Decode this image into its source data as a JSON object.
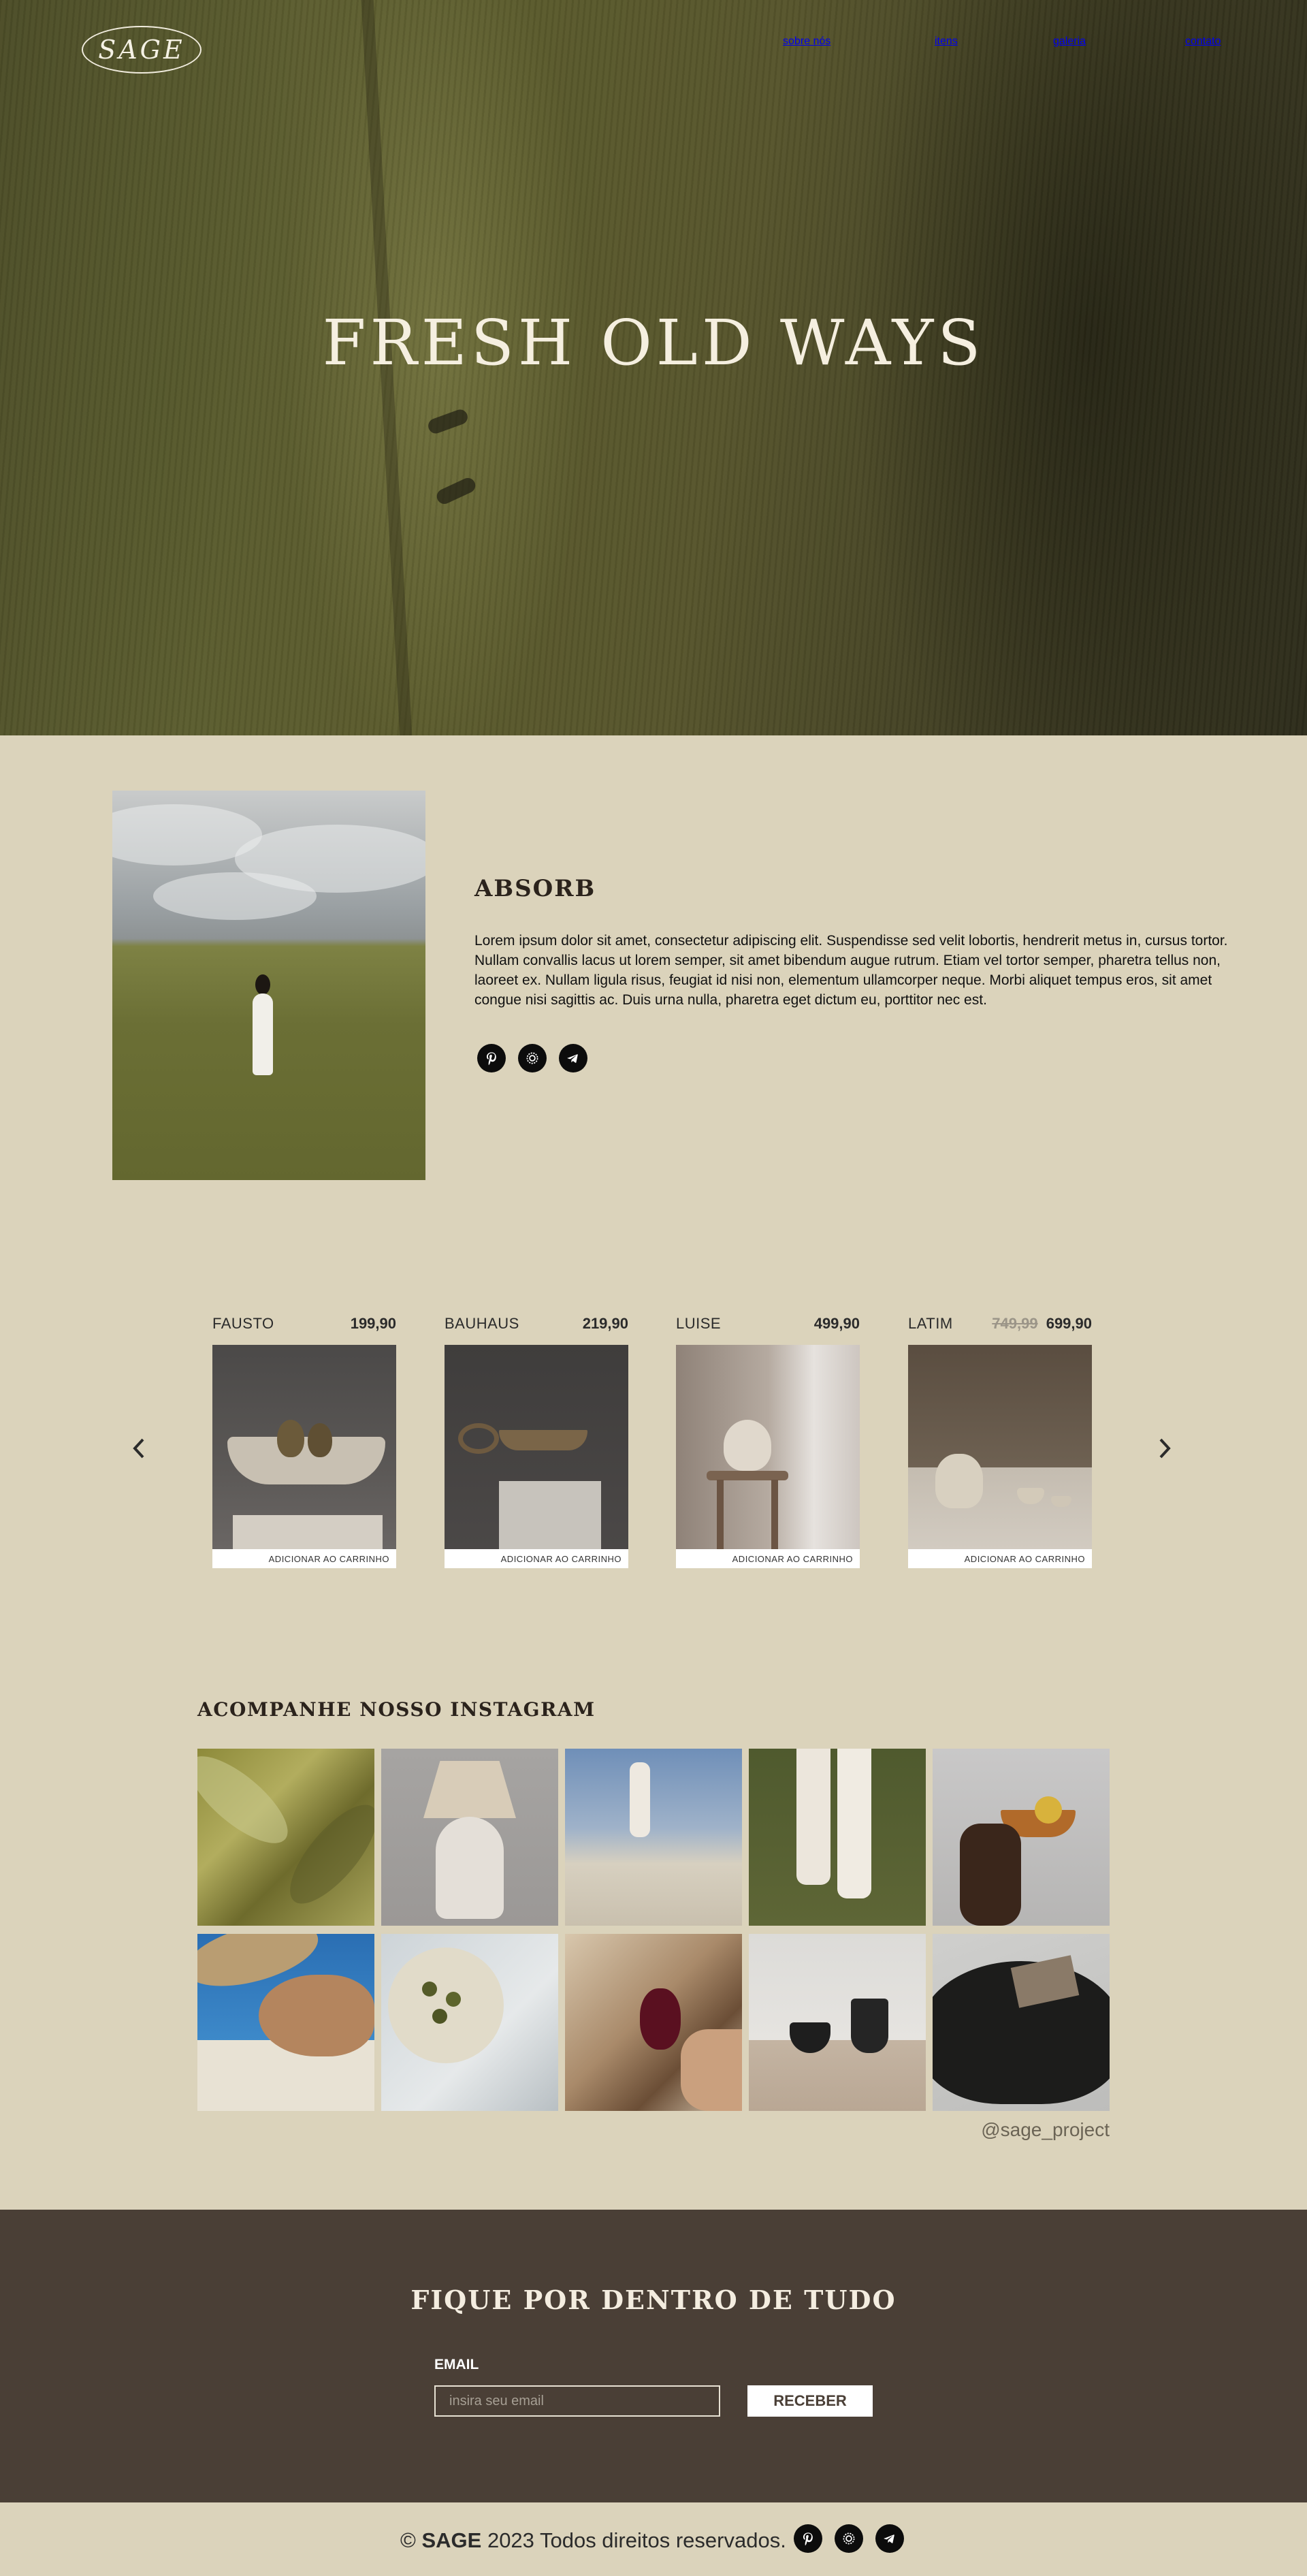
{
  "header": {
    "logo": "SAGE",
    "nav": [
      {
        "label": "sobre nós"
      },
      {
        "label": "itens"
      },
      {
        "label": "galeria"
      },
      {
        "label": "contato"
      }
    ]
  },
  "hero": {
    "title": "FRESH OLD WAYS"
  },
  "about": {
    "title": "ABSORB",
    "text": "Lorem ipsum dolor sit amet, consectetur adipiscing elit. Suspendisse sed velit lobortis, hendrerit metus in, cursus tortor. Nullam convallis lacus ut lorem semper, sit amet bibendum augue rutrum. Etiam vel tortor semper, pharetra tellus non, laoreet ex. Nullam ligula risus, feugiat id nisi non, elementum ullamcorper neque. Morbi aliquet tempus eros, sit amet congue nisi sagittis ac. Duis urna nulla, pharetra eget dictum eu, porttitor nec est.",
    "social": [
      "pinterest-icon",
      "instagram-icon",
      "telegram-icon"
    ]
  },
  "products": {
    "prev_icon": "chevron-left-icon",
    "next_icon": "chevron-right-icon",
    "items": [
      {
        "name": "FAUSTO",
        "price": "199,90",
        "old_price": "",
        "cart": "ADICIONAR AO CARRINHO"
      },
      {
        "name": "BAUHAUS",
        "price": "219,90",
        "old_price": "",
        "cart": "ADICIONAR AO CARRINHO"
      },
      {
        "name": "LUISE",
        "price": "499,90",
        "old_price": "",
        "cart": "ADICIONAR AO CARRINHO"
      },
      {
        "name": "LATIM",
        "price": "699,90",
        "old_price": "749,99",
        "cart": "ADICIONAR AO CARRINHO"
      }
    ]
  },
  "instagram": {
    "title": "ACOMPANHE NOSSO INSTAGRAM",
    "handle": "@sage_project"
  },
  "newsletter": {
    "title": "FIQUE POR DENTRO DE TUDO",
    "label": "EMAIL",
    "placeholder": "insira seu email",
    "button": "RECEBER"
  },
  "footer": {
    "copyright_symbol": "©",
    "brand": "SAGE",
    "text": "2023 Todos direitos reservados."
  },
  "colors": {
    "background": "#dbd3bb",
    "newsletter_bg": "#4a3f36",
    "text_dark": "#2b231c"
  }
}
